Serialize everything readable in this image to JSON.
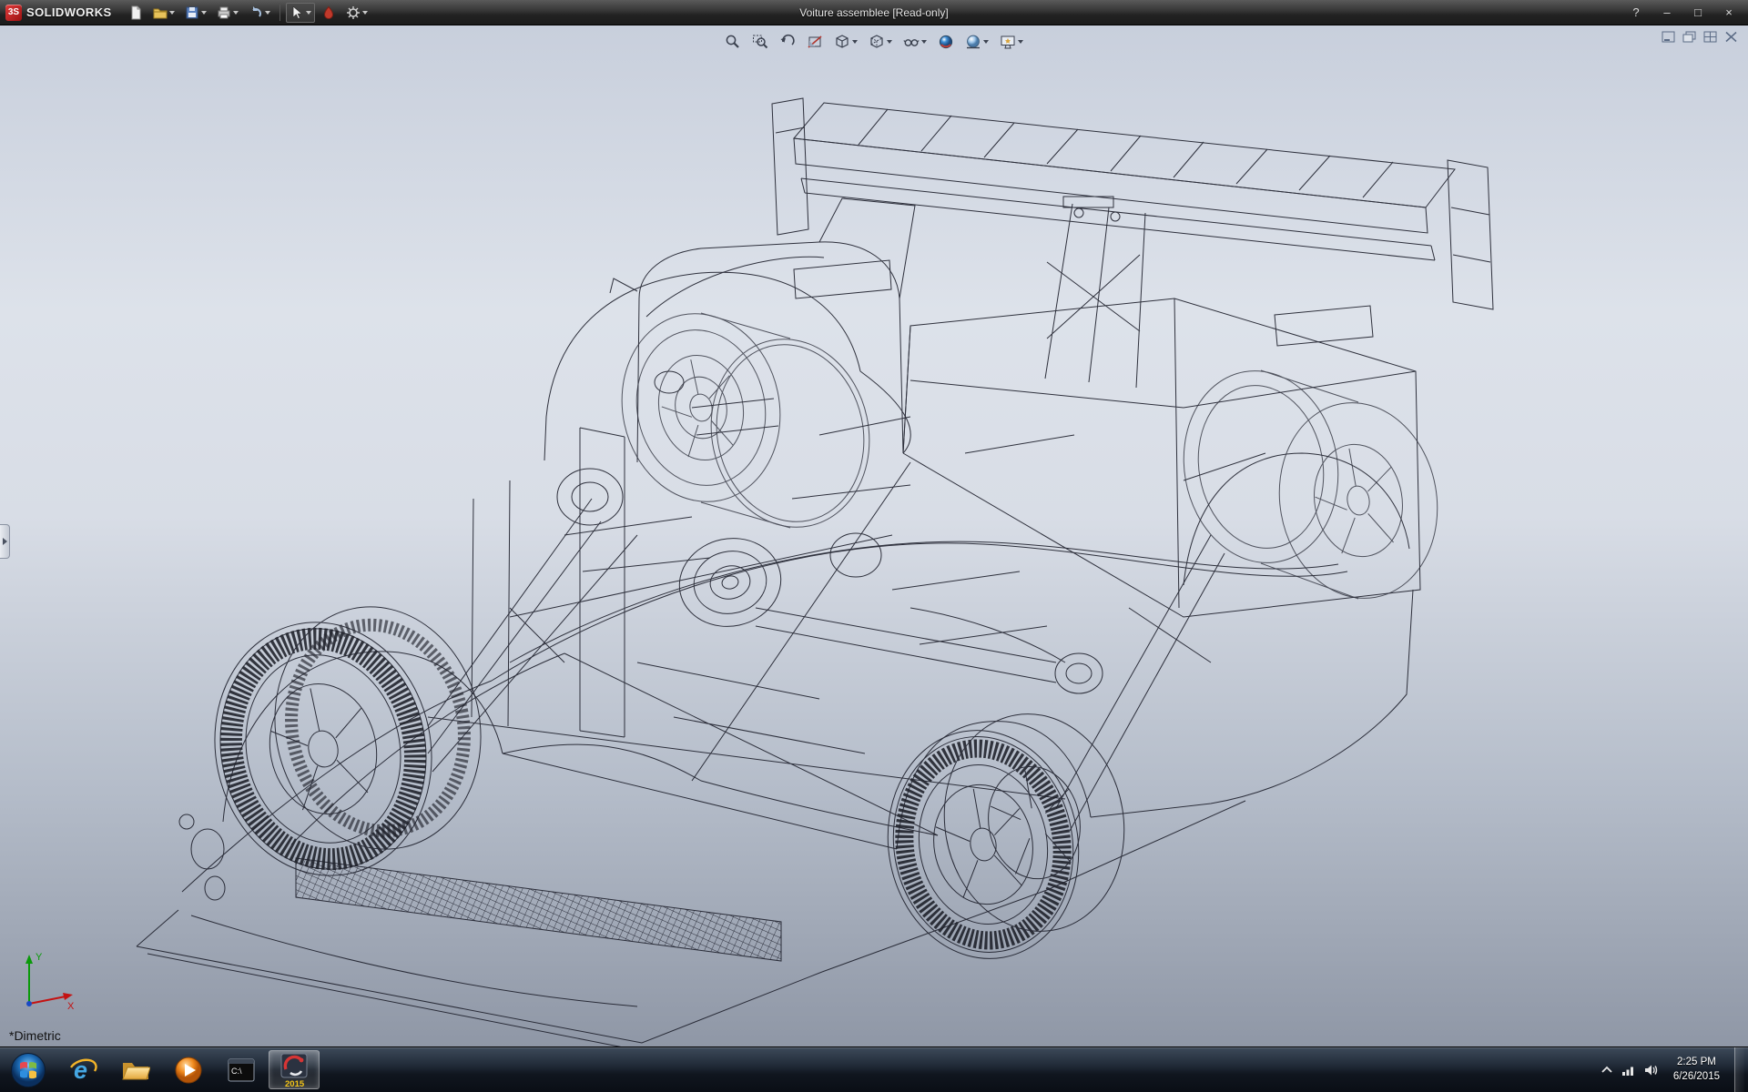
{
  "titlebar": {
    "logo_badge": "3S",
    "logo_text": "SOLIDWORKS",
    "title": "Voiture assemblee [Read-only]",
    "toolbar_icons": [
      "new-document-icon",
      "open-icon",
      "save-icon",
      "print-icon",
      "undo-icon",
      "select-cursor-icon",
      "appearance-icon",
      "options-icon"
    ],
    "window_controls": {
      "help": "?",
      "minimize": "–",
      "maximize": "□",
      "close": "×"
    }
  },
  "hud_icons": [
    "zoom-to-fit-icon",
    "zoom-to-area-icon",
    "previous-view-icon",
    "section-view-icon",
    "view-orientation-icon",
    "display-style-icon",
    "hide-show-items-icon",
    "edit-appearance-icon",
    "apply-scene-icon",
    "view-settings-icon"
  ],
  "document_window_icons": [
    "doc-minimize-icon",
    "doc-restore-icon",
    "doc-tile-icon",
    "doc-close-icon"
  ],
  "viewport": {
    "view_label": "*Dimetric",
    "triad": {
      "x": "X",
      "y": "Y"
    }
  },
  "taskbar": {
    "app_icons": [
      "start-orb",
      "internet-explorer-icon",
      "windows-explorer-icon",
      "media-player-icon",
      "command-prompt-icon",
      "solidworks-icon"
    ],
    "icons": {
      "ie_letter": "e",
      "cmd_label": "C:\\"
    },
    "solidworks_badge": "2015",
    "tray_icons": [
      "hidden-icons-chevron",
      "network-icon",
      "volume-icon"
    ],
    "tray": {
      "time": "2:25 PM",
      "date": "6/26/2015"
    }
  }
}
